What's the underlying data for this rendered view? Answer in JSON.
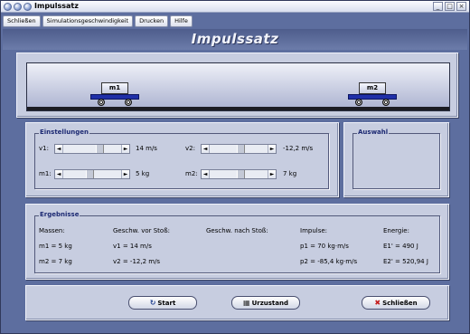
{
  "window": {
    "title": "Impulssatz",
    "controls": [
      "_",
      "□",
      "×"
    ]
  },
  "menu": {
    "items": [
      "Schließen",
      "Simulationsgeschwindigkeit",
      "Drucken",
      "Hilfe"
    ]
  },
  "app_title": "Impulssatz",
  "simulation": {
    "cart1_label": "m1",
    "cart2_label": "m2"
  },
  "einstellungen": {
    "group_label": "Einstellungen",
    "v1_label": "v1:",
    "v1_value": "14 m/s",
    "v2_label": "v2:",
    "v2_value": "-12,2 m/s",
    "m1_label": "m1:",
    "m1_value": "5 kg",
    "m2_label": "m2:",
    "m2_value": "7 kg",
    "slider_v1": 0.65,
    "slider_v2": 0.55,
    "slider_m1": 0.45,
    "slider_m2": 0.55
  },
  "auswahl": {
    "group_label": "Auswahl"
  },
  "ergebnisse": {
    "group_label": "Ergebnisse",
    "headers": [
      "Massen:",
      "Geschw. vor Stoß:",
      "Geschw. nach Stoß:",
      "Impulse:",
      "Energie:"
    ],
    "row1": {
      "mass": "m1 = 5 kg",
      "v_before": "v1 = 14 m/s",
      "v_after": "",
      "impulse": "p1 = 70 kg·m/s",
      "energy": "E1' = 490 J"
    },
    "row2": {
      "mass": "m2 = 7 kg",
      "v_before": "v2 = -12,2 m/s",
      "v_after": "",
      "impulse": "p2 = -85,4 kg·m/s",
      "energy": "E2' = 520,94 J"
    }
  },
  "buttons": {
    "start": "Start",
    "urzustand": "Urzustand",
    "schliessen": "Schließen"
  }
}
